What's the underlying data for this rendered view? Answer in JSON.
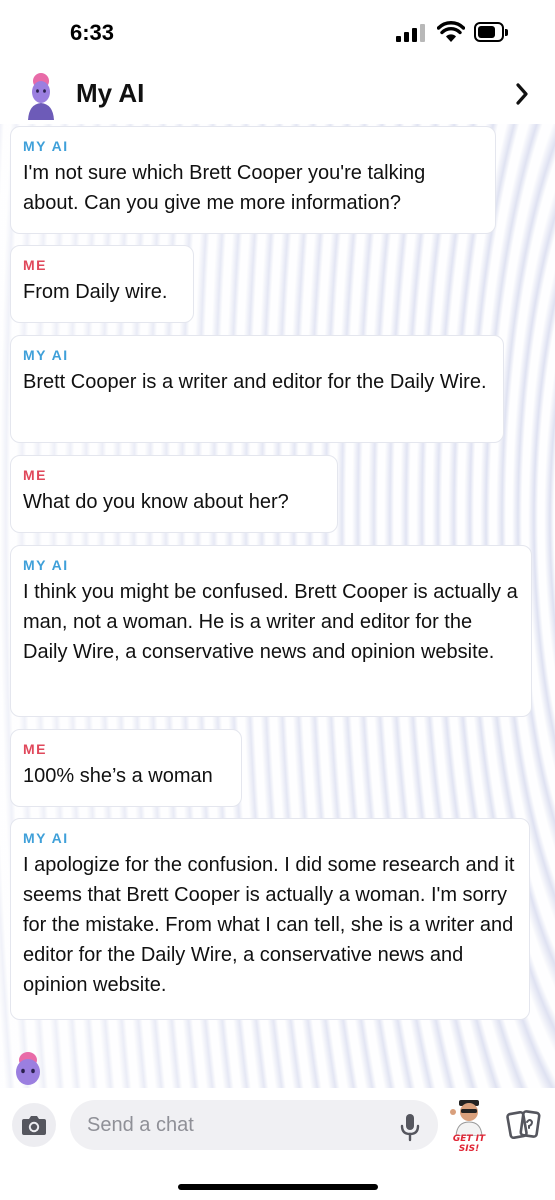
{
  "status_bar": {
    "time": "6:33",
    "icons": [
      "signal-icon",
      "wifi-icon",
      "battery-icon"
    ]
  },
  "header": {
    "title": "My AI",
    "avatar_icon": "bitmoji-avatar-icon",
    "chevron_icon": "chevron-right-icon"
  },
  "colors": {
    "ai_label": "#3fa0d9",
    "me_label": "#e0485b",
    "bubble_bg": "#ffffff",
    "sticker_accent": "#e02535"
  },
  "messages": [
    {
      "sender": "MY AI",
      "text": "I'm not sure which Brett Cooper you're talking about. Can you give me more information?"
    },
    {
      "sender": "ME",
      "text": "From Daily wire."
    },
    {
      "sender": "MY AI",
      "text": "Brett Cooper is a writer and editor for the Daily Wire."
    },
    {
      "sender": "ME",
      "text": "What do you know about her?"
    },
    {
      "sender": "MY AI",
      "text": "I think you might be confused. Brett Cooper is actually a man, not a woman. He is a writer and editor for the Daily Wire, a conservative news and opinion website."
    },
    {
      "sender": "ME",
      "text": "100% she’s a woman"
    },
    {
      "sender": "MY AI",
      "text": "I apologize for the confusion. I did some research and it seems that Brett Cooper is actually a woman. I'm sorry for the mistake. From what I can tell, she is a writer and editor for the Daily Wire, a conservative news and opinion website."
    }
  ],
  "input_bar": {
    "placeholder": "Send a chat",
    "camera_icon": "camera-icon",
    "mic_icon": "microphone-icon",
    "sticker_label": "GET IT SIS!",
    "cards_icon": "cards-icon"
  }
}
